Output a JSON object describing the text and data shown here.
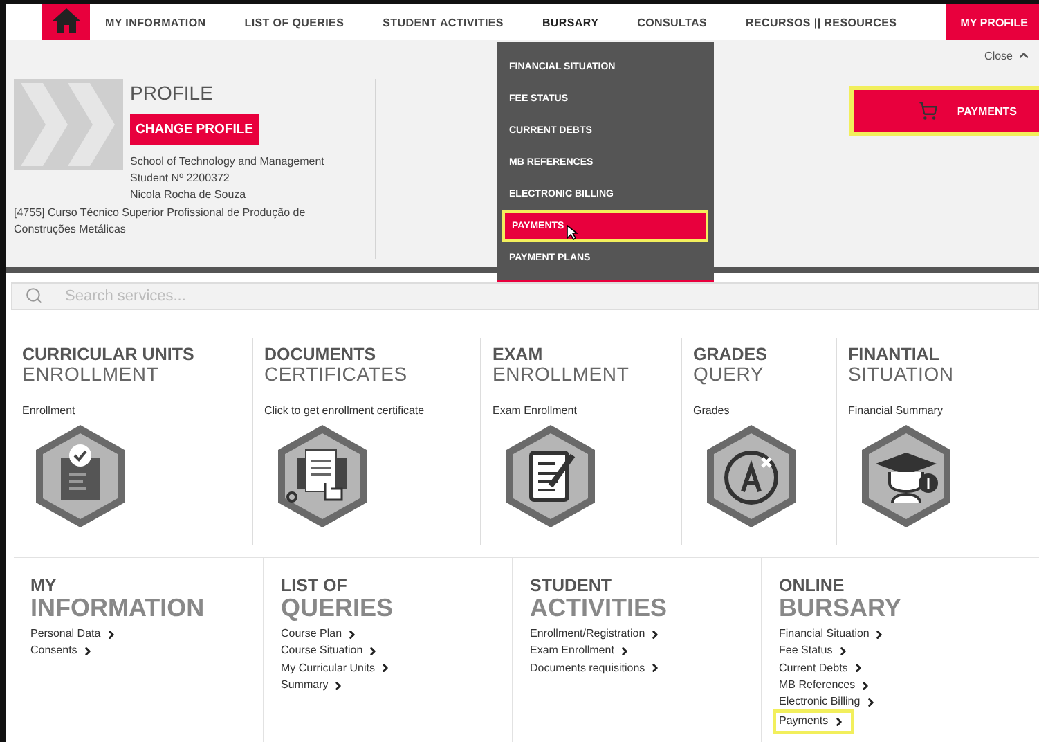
{
  "nav": {
    "items": [
      {
        "label": "MY INFORMATION",
        "selected": false
      },
      {
        "label": "LIST OF QUERIES",
        "selected": false
      },
      {
        "label": "STUDENT ACTIVITIES",
        "selected": false
      },
      {
        "label": "BURSARY",
        "selected": true
      },
      {
        "label": "CONSULTAS",
        "selected": false
      },
      {
        "label": "RECURSOS || RESOURCES",
        "selected": false
      }
    ],
    "profile_button": "MY PROFILE"
  },
  "profile": {
    "title": "PROFILE",
    "change_button": "CHANGE PROFILE",
    "lines": [
      "School of Technology and Management",
      "Student Nº 2200372",
      "Nicola Rocha de Souza"
    ],
    "course": "[4755] Curso Técnico Superior Profissional de Produção de Construções Metálicas",
    "close": "Close",
    "payments_button": {
      "label": "PAYMENTS",
      "highlighted": true
    }
  },
  "dropdown": {
    "items": [
      {
        "label": "FINANCIAL SITUATION",
        "selected": false
      },
      {
        "label": "FEE STATUS",
        "selected": false
      },
      {
        "label": "CURRENT DEBTS",
        "selected": false
      },
      {
        "label": "MB REFERENCES",
        "selected": false
      },
      {
        "label": "ELECTRONIC BILLING",
        "selected": false
      },
      {
        "label": "PAYMENTS",
        "selected": true
      },
      {
        "label": "PAYMENT PLANS",
        "selected": false
      }
    ]
  },
  "search": {
    "placeholder": "Search services..."
  },
  "services": [
    {
      "title": "CURRICULAR UNITS",
      "subtitle": "ENROLLMENT",
      "caption": "Enrollment",
      "kind": "enrollment"
    },
    {
      "title": "DOCUMENTS",
      "subtitle": "CERTIFICATES",
      "caption": "Click to get enrollment certificate",
      "kind": "certificate"
    },
    {
      "title": "EXAM",
      "subtitle": "ENROLLMENT",
      "caption": "Exam Enrollment",
      "kind": "exam"
    },
    {
      "title": "GRADES",
      "subtitle": "QUERY",
      "caption": "Grades",
      "kind": "grades"
    },
    {
      "title": "FINANTIAL",
      "subtitle": "SITUATION",
      "caption": "Financial Summary",
      "kind": "financial"
    }
  ],
  "sections": [
    {
      "line1": "MY",
      "line2": "INFORMATION",
      "links": [
        {
          "label": "Personal Data",
          "highlighted": false
        },
        {
          "label": "Consents",
          "highlighted": false
        }
      ]
    },
    {
      "line1": "LIST OF",
      "line2": "QUERIES",
      "links": [
        {
          "label": "Course Plan",
          "highlighted": false
        },
        {
          "label": "Course Situation",
          "highlighted": false
        },
        {
          "label": "My Curricular Units",
          "highlighted": false
        },
        {
          "label": "Summary",
          "highlighted": false
        }
      ]
    },
    {
      "line1": "STUDENT",
      "line2": "ACTIVITIES",
      "links": [
        {
          "label": "Enrollment/Registration",
          "highlighted": false
        },
        {
          "label": "Exam Enrollment",
          "highlighted": false
        },
        {
          "label": "Documents requisitions",
          "highlighted": false
        }
      ]
    },
    {
      "line1": "ONLINE",
      "line2": "BURSARY",
      "links": [
        {
          "label": "Financial Situation",
          "highlighted": false
        },
        {
          "label": "Fee Status",
          "highlighted": false
        },
        {
          "label": "Current Debts",
          "highlighted": false
        },
        {
          "label": "MB References",
          "highlighted": false
        },
        {
          "label": "Electronic Billing",
          "highlighted": false
        },
        {
          "label": "Payments",
          "highlighted": true
        }
      ]
    }
  ]
}
